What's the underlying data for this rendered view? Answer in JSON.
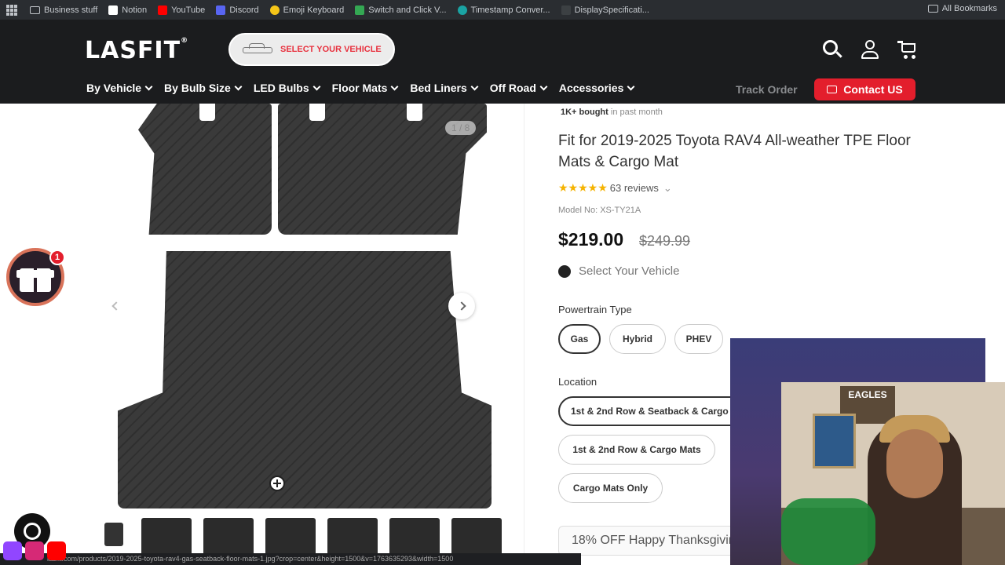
{
  "bookmarks": {
    "items": [
      {
        "label": "Business stuff",
        "icon": "folder-icon",
        "color": "#9aa0a6"
      },
      {
        "label": "Notion",
        "icon": "notion-icon",
        "color": "#ffffff"
      },
      {
        "label": "YouTube",
        "icon": "youtube-icon",
        "color": "#ff0000"
      },
      {
        "label": "Discord",
        "icon": "discord-icon",
        "color": "#5865f2"
      },
      {
        "label": "Emoji Keyboard",
        "icon": "emoji-icon",
        "color": "#f5c518"
      },
      {
        "label": "Switch and Click V...",
        "icon": "drive-icon",
        "color": "#34a853"
      },
      {
        "label": "Timestamp Conver...",
        "icon": "globe-icon",
        "color": "#1aa3a3"
      },
      {
        "label": "DisplaySpecificati...",
        "icon": "page-icon",
        "color": "#3c4043"
      }
    ],
    "all_label": "All Bookmarks"
  },
  "header": {
    "logo": "LASFIT",
    "select_vehicle": "SELECT YOUR VEHICLE",
    "nav": [
      "By Vehicle",
      "By Bulb Size",
      "LED Bulbs",
      "Floor Mats",
      "Bed Liners",
      "Off Road",
      "Accessories"
    ],
    "track_order": "Track Order",
    "contact": "Contact US",
    "accent": "#e31e2c"
  },
  "gallery": {
    "slide_counter": "1 / 8",
    "gift_badge": "1"
  },
  "product": {
    "bought_bold": "1K+ bought",
    "bought_rest": " in past month",
    "title": "Fit for 2019-2025 Toyota RAV4 All-weather TPE Floor Mats & Cargo Mat",
    "stars": "★★★★★",
    "reviews": "63 reviews",
    "model": "Model No: XS-TY21A",
    "price": "$219.00",
    "old_price": "$249.99",
    "select_vehicle": "Select Your Vehicle",
    "powertrain_label": "Powertrain Type",
    "powertrain_options": [
      "Gas",
      "Hybrid",
      "PHEV"
    ],
    "location_label": "Location",
    "location_options": [
      "1st & 2nd Row & Seatback & Cargo Mats",
      "1st & 2nd Row & Cargo Mats",
      "Cargo Mats Only"
    ],
    "promo": "18% OFF Happy Thanksgiving"
  },
  "webcam": {
    "sign": "EAGLES"
  },
  "status_url": "lasfit.com/products/2019-2025-toyota-rav4-gas-seatback-floor-mats-1.jpg?crop=center&height=1500&v=1763635293&width=1500"
}
